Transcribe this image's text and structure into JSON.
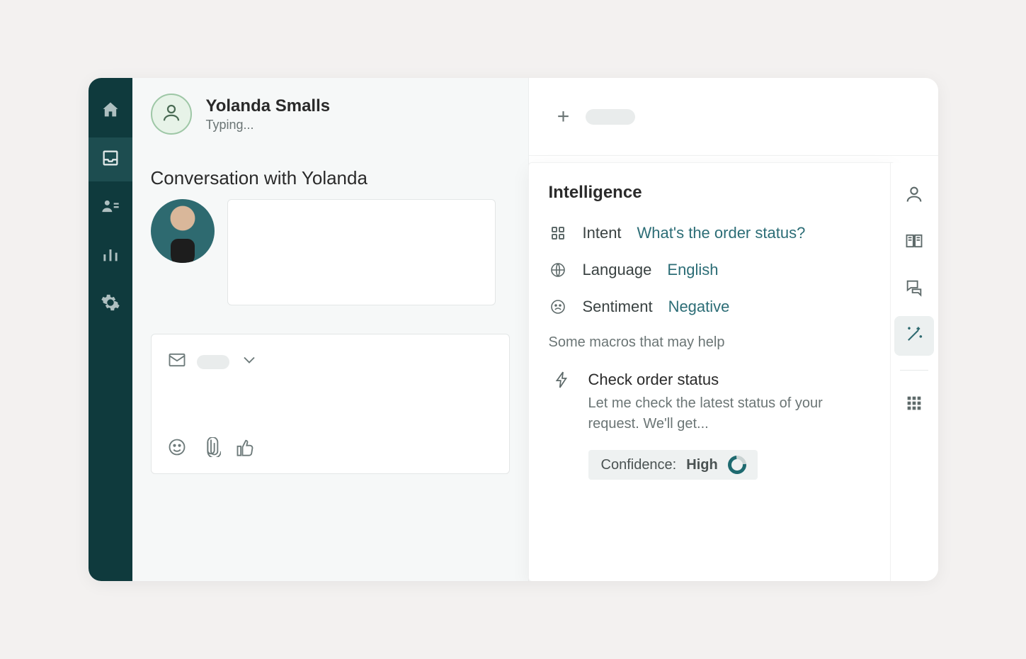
{
  "customer": {
    "name": "Yolanda Smalls",
    "status": "Typing..."
  },
  "conversation": {
    "title": "Conversation with Yolanda"
  },
  "intelligence": {
    "title": "Intelligence",
    "intent_label": "Intent",
    "intent_value": "What's the order status?",
    "language_label": "Language",
    "language_value": "English",
    "sentiment_label": "Sentiment",
    "sentiment_value": "Negative",
    "macros_help": "Some macros that may help",
    "macro_title": "Check order status",
    "macro_desc": "Let me check the latest status of your request. We'll get...",
    "confidence_label": "Confidence:",
    "confidence_value": "High"
  },
  "leftnav": {
    "items": [
      "home",
      "inbox",
      "contacts",
      "analytics",
      "settings"
    ],
    "active": "inbox"
  },
  "rightrail": {
    "items": [
      "profile",
      "knowledge",
      "conversations",
      "intelligence",
      "apps"
    ],
    "active": "intelligence"
  },
  "colors": {
    "nav_bg": "#0f3a3d",
    "accent": "#2c6d76"
  }
}
